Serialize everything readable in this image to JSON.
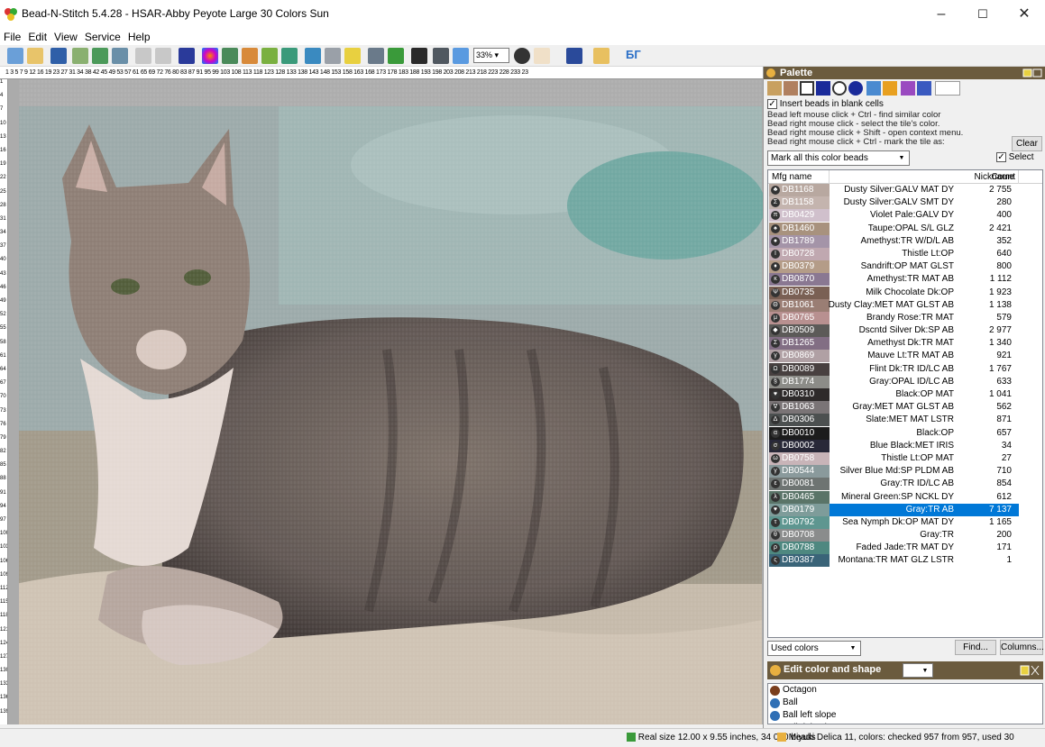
{
  "window": {
    "title": "Bead-N-Stitch 5.4.28 - HSAR-Abby Peyote Large 30 Colors Sun"
  },
  "menu": [
    "File",
    "Edit",
    "View",
    "Service",
    "Help"
  ],
  "toolbar": {
    "zoom": "33%",
    "lang_label": "БГ"
  },
  "ruler_top": "1 3 5 7 9 12 16 19 23 27 31 34 38 42 45 49 53 57 61 65 69 72 76 80 83 87 91 95 99 103 108 113 118 123 128 133 138 143 148 153 158 163 168 173 178 183 188 193 198 203 208 213 218 223 228 233 23",
  "ruler_left": [
    "1",
    "4",
    "7",
    "10",
    "13",
    "16",
    "19",
    "22",
    "25",
    "28",
    "31",
    "34",
    "37",
    "40",
    "43",
    "46",
    "49",
    "52",
    "55",
    "58",
    "61",
    "64",
    "67",
    "70",
    "73",
    "76",
    "79",
    "82",
    "85",
    "88",
    "91",
    "94",
    "97",
    "100",
    "103",
    "106",
    "109",
    "112",
    "115",
    "118",
    "121",
    "124",
    "127",
    "130",
    "133",
    "136",
    "139"
  ],
  "palette": {
    "title": "Palette",
    "insert_label": "Insert beads in blank cells",
    "hints": [
      "Bead left  mouse click + Ctrl - find similar color",
      "Bead right mouse click - select the tile's color.",
      "Bead right mouse click + Shift - open context menu.",
      "Bead right mouse click + Ctrl - mark the tile as:"
    ],
    "clear_button": "Clear",
    "mark_option": "Mark all this color beads",
    "select_label": "Select",
    "columns": {
      "mfg": "Mfg name",
      "nick": "Nickname",
      "count": "Count"
    },
    "rows": [
      {
        "mfg": "DB1168",
        "nick": "Dusty Silver:GALV MAT DY",
        "count": "2 755",
        "color": "#b8a8a0",
        "sym": "♣"
      },
      {
        "mfg": "DB1158",
        "nick": "Dusty Silver:GALV SMT DY",
        "count": "280",
        "color": "#c4b4ae",
        "sym": "Σ"
      },
      {
        "mfg": "DB0429",
        "nick": "Violet Pale:GALV DY",
        "count": "400",
        "color": "#d0c0cc",
        "sym": "π"
      },
      {
        "mfg": "DB1460",
        "nick": "Taupe:OPAL S/L GLZ",
        "count": "2 421",
        "color": "#a8927e",
        "sym": "♠"
      },
      {
        "mfg": "DB1789",
        "nick": "Amethyst:TR W/D/L AB",
        "count": "352",
        "color": "#a494a8",
        "sym": "●"
      },
      {
        "mfg": "DB0728",
        "nick": "Thistle Lt:OP",
        "count": "640",
        "color": "#c0a8b0",
        "sym": "I"
      },
      {
        "mfg": "DB0379",
        "nick": "Sandrift:OP MAT GLST",
        "count": "800",
        "color": "#b49c88",
        "sym": "♦"
      },
      {
        "mfg": "DB0870",
        "nick": "Amethyst:TR MAT AB",
        "count": "1 112",
        "color": "#8a7892",
        "sym": "κ"
      },
      {
        "mfg": "DB0735",
        "nick": "Milk Chocolate Dk:OP",
        "count": "1 923",
        "color": "#7a6054",
        "sym": "Ψ"
      },
      {
        "mfg": "DB1061",
        "nick": "Dusty Clay:MET MAT GLST AB",
        "count": "1 138",
        "color": "#9a7e74",
        "sym": "Θ"
      },
      {
        "mfg": "DB0765",
        "nick": "Brandy Rose:TR MAT",
        "count": "579",
        "color": "#b89090",
        "sym": "μ"
      },
      {
        "mfg": "DB0509",
        "nick": "Dscntd Silver Dk:SP AB",
        "count": "2 977",
        "color": "#5c5a58",
        "sym": "◆"
      },
      {
        "mfg": "DB1265",
        "nick": "Amethyst Dk:TR MAT",
        "count": "1 340",
        "color": "#826e84",
        "sym": "Σ"
      },
      {
        "mfg": "DB0869",
        "nick": "Mauve Lt:TR MAT AB",
        "count": "921",
        "color": "#b0a0a4",
        "sym": "γ"
      },
      {
        "mfg": "DB0089",
        "nick": "Flint Dk:TR ID/LC AB",
        "count": "1 767",
        "color": "#484040",
        "sym": "Ω"
      },
      {
        "mfg": "DB1774",
        "nick": "Gray:OPAL ID/LC AB",
        "count": "633",
        "color": "#8c8c88",
        "sym": "§"
      },
      {
        "mfg": "DB0310",
        "nick": "Black:OP MAT",
        "count": "1 041",
        "color": "#2e2a2a",
        "sym": "♥"
      },
      {
        "mfg": "DB1063",
        "nick": "Gray:MET MAT GLST AB",
        "count": "562",
        "color": "#7a7476",
        "sym": "∇"
      },
      {
        "mfg": "DB0306",
        "nick": "Slate:MET MAT LSTR",
        "count": "871",
        "color": "#4c5050",
        "sym": "Δ"
      },
      {
        "mfg": "DB0010",
        "nick": "Black:OP",
        "count": "657",
        "color": "#1c1c1c",
        "sym": "α"
      },
      {
        "mfg": "DB0002",
        "nick": "Blue Black:MET IRIS",
        "count": "34",
        "color": "#282838",
        "sym": "σ"
      },
      {
        "mfg": "DB0758",
        "nick": "Thistle Lt:OP MAT",
        "count": "27",
        "color": "#c8b4b8",
        "sym": "ω"
      },
      {
        "mfg": "DB0544",
        "nick": "Silver Blue Md:SP PLDM AB",
        "count": "710",
        "color": "#8a9a9c",
        "sym": "γ"
      },
      {
        "mfg": "DB0081",
        "nick": "Gray:TR ID/LC AB",
        "count": "854",
        "color": "#6e7472",
        "sym": "ε"
      },
      {
        "mfg": "DB0465",
        "nick": "Mineral Green:SP NCKL DY",
        "count": "612",
        "color": "#5a7468",
        "sym": "λ"
      },
      {
        "mfg": "DB0179",
        "nick": "Gray:TR AB",
        "count": "7 137",
        "color": "#7e9c9a",
        "sym": "♥"
      },
      {
        "mfg": "DB0792",
        "nick": "Sea Nymph Dk:OP MAT DY",
        "count": "1 165",
        "color": "#5e9690",
        "sym": "τ"
      },
      {
        "mfg": "DB0708",
        "nick": "Gray:TR",
        "count": "200",
        "color": "#8a8c8c",
        "sym": "θ"
      },
      {
        "mfg": "DB0788",
        "nick": "Faded Jade:TR MAT DY",
        "count": "171",
        "color": "#4e8880",
        "sym": "ρ"
      },
      {
        "mfg": "DB0387",
        "nick": "Montana:TR MAT GLZ LSTR",
        "count": "1",
        "color": "#3a6478",
        "sym": "ς"
      }
    ],
    "selected_index": 25,
    "filter": "Used colors",
    "find_button": "Find...",
    "columns_button": "Columns..."
  },
  "edit_shape": {
    "title": "Edit color and shape",
    "shapes": [
      {
        "label": "Octagon",
        "color": "#7a3e1c"
      },
      {
        "label": "Ball",
        "color": "#2f6fb5"
      },
      {
        "label": "Ball left slope",
        "color": "#2f6fb5"
      },
      {
        "label": "Ball right slope",
        "color": "#2f6fb5"
      }
    ]
  },
  "status": {
    "real_size": "Real size 12.00 x 9.55 inches, 34 080 beads",
    "info": "Miyuki Delica 11, colors: checked 957 from 957, used 30"
  },
  "colors": {
    "header": "#6b5b3e",
    "selection": "#0078d7",
    "canvas_bg": "#ababab"
  }
}
